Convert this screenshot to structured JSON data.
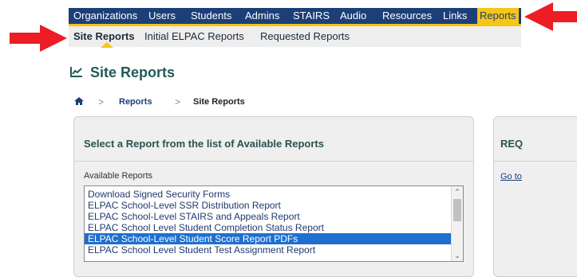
{
  "top_nav": {
    "items": [
      {
        "label": "Organizations"
      },
      {
        "label": "Users"
      },
      {
        "label": "Students"
      },
      {
        "label": "Admins"
      },
      {
        "label": "STAIRS"
      },
      {
        "label": "Audio"
      },
      {
        "label": "Resources"
      },
      {
        "label": "Links"
      },
      {
        "label": "Reports"
      }
    ],
    "active": "Reports"
  },
  "sub_nav": {
    "items": [
      {
        "label": "Site Reports"
      },
      {
        "label": "Initial ELPAC Reports"
      },
      {
        "label": "Requested Reports"
      }
    ],
    "active": "Site Reports"
  },
  "page": {
    "title": "Site Reports",
    "title_icon": "line-chart-icon"
  },
  "breadcrumb": {
    "home_icon": "home-icon",
    "items": [
      "Reports",
      "Site Reports"
    ]
  },
  "report_panel": {
    "heading": "Select a Report from the list of Available Reports",
    "list_label": "Available Reports",
    "options": [
      "Download Signed Security Forms",
      "ELPAC School-Level SSR Distribution Report",
      "ELPAC School-Level STAIRS and Appeals Report",
      "ELPAC School Level Student Completion Status Report",
      "ELPAC School-Level Student Score Report PDFs",
      "ELPAC School Level Student Test Assignment Report"
    ],
    "selected": "ELPAC School-Level Student Score Report PDFs"
  },
  "side_panel": {
    "heading": "REQ",
    "link": "Go to"
  },
  "colors": {
    "nav_bg": "#1c3f78",
    "nav_accent": "#f5c518",
    "selection": "#1e6fd0",
    "title": "#1f5c58",
    "annotation_arrow": "#ee1c24"
  }
}
